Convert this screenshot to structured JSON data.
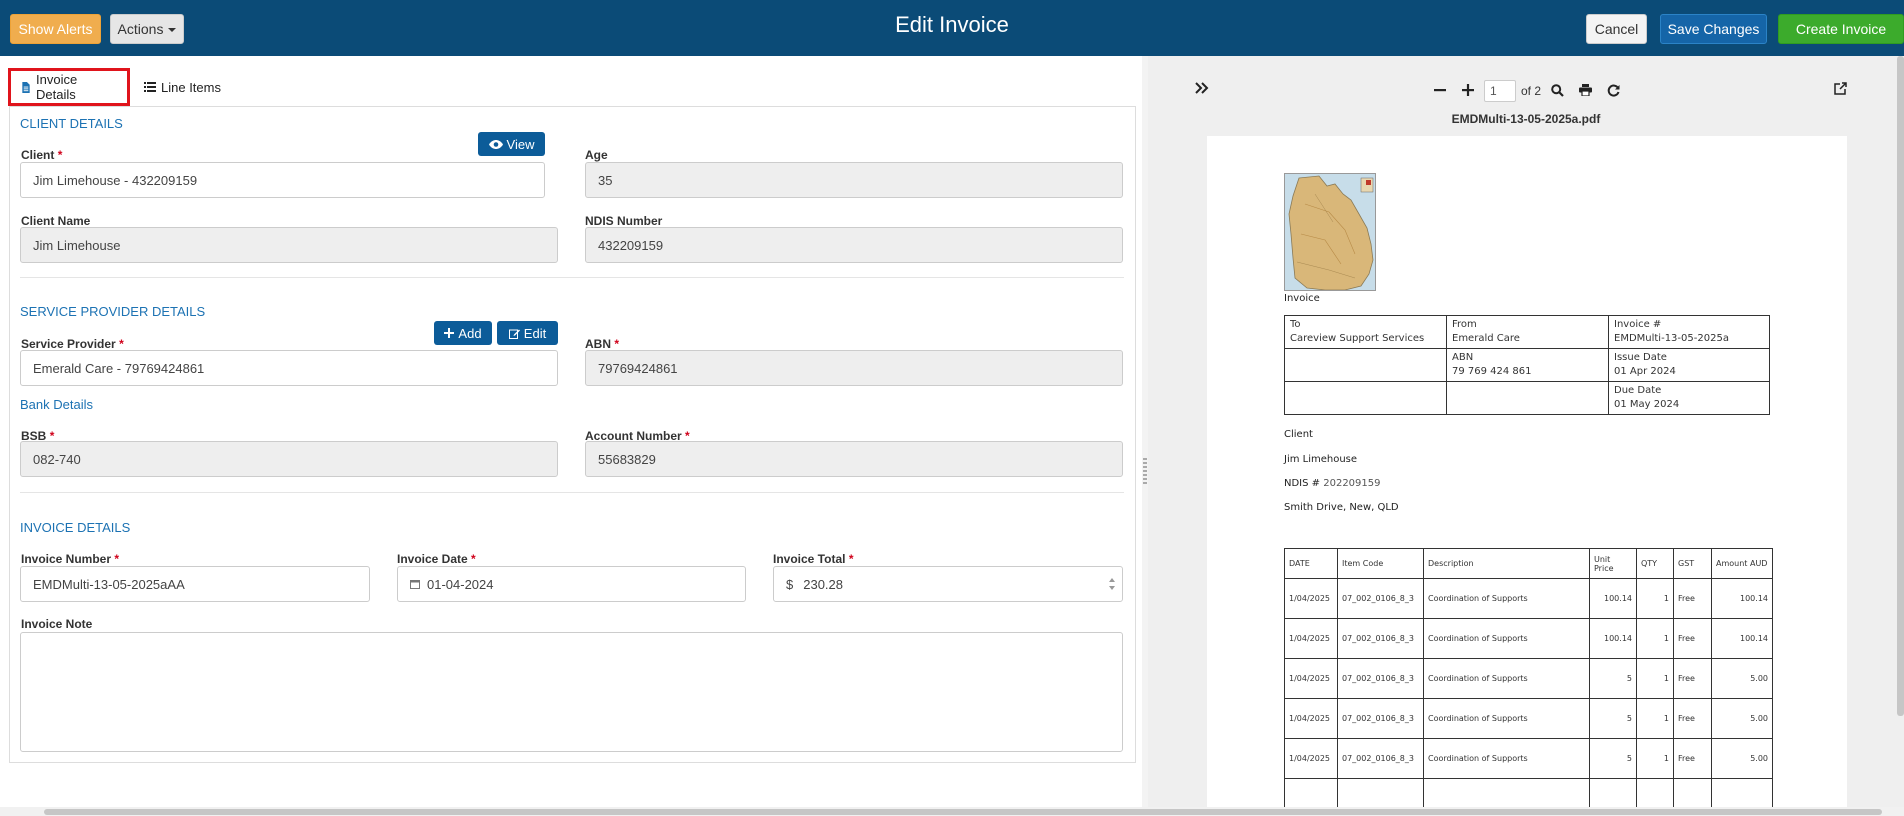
{
  "header": {
    "title": "Edit Invoice",
    "show_alerts": "Show Alerts",
    "actions": "Actions",
    "cancel": "Cancel",
    "save_changes": "Save Changes",
    "create_invoice": "Create Invoice",
    "colors": {
      "bar": "#0b4b77",
      "warning": "#f0ad4e",
      "primary": "#1565a8",
      "success": "#3cab2c"
    }
  },
  "tabs": [
    {
      "label": "Invoice Details",
      "icon": "file-icon",
      "active": true
    },
    {
      "label": "Line Items",
      "icon": "list-icon",
      "active": false
    }
  ],
  "client_details": {
    "section_title": "CLIENT DETAILS",
    "view_button": "View",
    "client_label": "Client",
    "client_value": "Jim Limehouse - 432209159",
    "age_label": "Age",
    "age_value": "35",
    "client_name_label": "Client Name",
    "client_name_value": "Jim Limehouse",
    "ndis_label": "NDIS Number",
    "ndis_value": "432209159"
  },
  "service_provider": {
    "section_title": "SERVICE PROVIDER DETAILS",
    "add_button": "Add",
    "edit_button": "Edit",
    "provider_label": "Service Provider",
    "provider_value": "Emerald Care - 79769424861",
    "abn_label": "ABN",
    "abn_value": "79769424861",
    "bank_title": "Bank Details",
    "bsb_label": "BSB",
    "bsb_value": "082-740",
    "account_label": "Account Number",
    "account_value": "55683829"
  },
  "invoice_details": {
    "section_title": "INVOICE DETAILS",
    "number_label": "Invoice Number",
    "number_value": "EMDMulti-13-05-2025aAA",
    "date_label": "Invoice Date",
    "date_value": "01-04-2024",
    "total_label": "Invoice Total",
    "currency_symbol": "$",
    "total_value": "230.28",
    "note_label": "Invoice Note",
    "note_value": ""
  },
  "viewer": {
    "page": "1",
    "of_total": "of 2",
    "file_name": "EMDMulti-13-05-2025a.pdf"
  },
  "pdf": {
    "heading": "Invoice",
    "to_label": "To",
    "to_value": "Careview Support Services",
    "from_label": "From",
    "from_value": "Emerald Care",
    "abn_label": "ABN",
    "abn_value": "79 769 424 861",
    "invoice_no_label": "Invoice #",
    "invoice_no_value": "EMDMulti-13-05-2025a",
    "issue_label": "Issue Date",
    "issue_value": "01 Apr 2024",
    "due_label": "Due Date",
    "due_value": "01 May 2024",
    "client_label": "Client",
    "client_name": "Jim Limehouse",
    "ndis_label": "NDIS #",
    "ndis_value": "202209159",
    "address": "Smith Drive, New, QLD",
    "line_headers": [
      "DATE",
      "Item Code",
      "Description",
      "Unit Price",
      "QTY",
      "GST",
      "Amount AUD"
    ],
    "lines": [
      [
        "1/04/2025",
        "07_002_0106_8_3",
        "Coordination of Supports",
        "100.14",
        "1",
        "Free",
        "100.14"
      ],
      [
        "1/04/2025",
        "07_002_0106_8_3",
        "Coordination of Supports",
        "100.14",
        "1",
        "Free",
        "100.14"
      ],
      [
        "1/04/2025",
        "07_002_0106_8_3",
        "Coordination of Supports",
        "5",
        "1",
        "Free",
        "5.00"
      ],
      [
        "1/04/2025",
        "07_002_0106_8_3",
        "Coordination of Supports",
        "5",
        "1",
        "Free",
        "5.00"
      ],
      [
        "1/04/2025",
        "07_002_0106_8_3",
        "Coordination of Supports",
        "5",
        "1",
        "Free",
        "5.00"
      ]
    ]
  }
}
